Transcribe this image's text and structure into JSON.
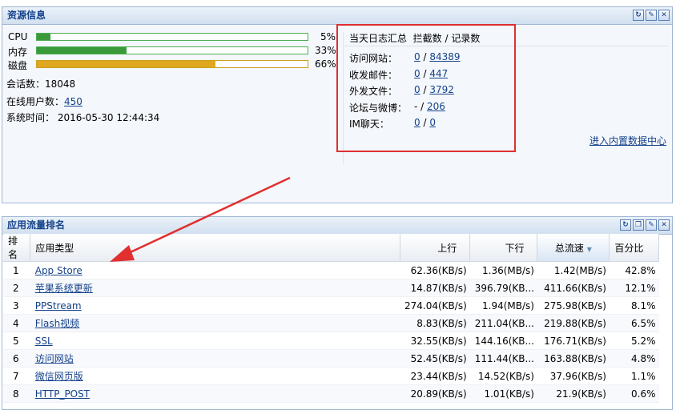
{
  "resource_panel": {
    "title": "资源信息",
    "bars": [
      {
        "label": "CPU",
        "percent_text": "5%",
        "value": 0.05,
        "color": "#3a9a3a"
      },
      {
        "label": "内存",
        "percent_text": "33%",
        "value": 0.33,
        "color": "#3a9a3a"
      },
      {
        "label": "磁盘",
        "percent_text": "66%",
        "value": 0.66,
        "color": "#e0a820"
      }
    ],
    "sessions": "会话数：18048",
    "online_users_label": "在线用户数：",
    "online_users_value": "450",
    "system_time": "系统时间： 2016-05-30 12:44:34",
    "log_summary": {
      "title": "当天日志汇总",
      "columns": "拦截数 / 记录数",
      "rows": [
        {
          "label": "访问网站：",
          "blocked": "0",
          "records": "84389"
        },
        {
          "label": "收发邮件：",
          "blocked": "0",
          "records": "447"
        },
        {
          "label": "外发文件：",
          "blocked": "0",
          "records": "3792"
        },
        {
          "label": "论坛与微博：",
          "blocked": "-",
          "records": "206"
        },
        {
          "label": "IM聊天：",
          "blocked": "0",
          "records": "0"
        }
      ]
    },
    "data_center_link": "进入内置数据中心"
  },
  "ranking_panel": {
    "title": "应用流量排名",
    "columns": {
      "rank": "排名",
      "app": "应用类型",
      "up": "上行",
      "down": "下行",
      "total": "总流速",
      "percent": "百分比"
    },
    "rows": [
      {
        "rank": "1",
        "app": "App Store",
        "up": "62.36(KB/s)",
        "down": "1.36(MB/s)",
        "total": "1.42(MB/s)",
        "percent": "42.8%"
      },
      {
        "rank": "2",
        "app": "苹果系统更新",
        "up": "14.87(KB/s)",
        "down": "396.79(KB...",
        "total": "411.66(KB/s)",
        "percent": "12.1%"
      },
      {
        "rank": "3",
        "app": "PPStream",
        "up": "274.04(KB/s)",
        "down": "1.94(MB/s)",
        "total": "275.98(KB/s)",
        "percent": "8.1%"
      },
      {
        "rank": "4",
        "app": "Flash视频",
        "up": "8.83(KB/s)",
        "down": "211.04(KB...",
        "total": "219.88(KB/s)",
        "percent": "6.5%"
      },
      {
        "rank": "5",
        "app": "SSL",
        "up": "32.55(KB/s)",
        "down": "144.16(KB...",
        "total": "176.71(KB/s)",
        "percent": "5.2%"
      },
      {
        "rank": "6",
        "app": "访问网站",
        "up": "52.45(KB/s)",
        "down": "111.44(KB...",
        "total": "163.88(KB/s)",
        "percent": "4.8%"
      },
      {
        "rank": "7",
        "app": "微信网页版",
        "up": "23.44(KB/s)",
        "down": "14.52(KB/s)",
        "total": "37.96(KB/s)",
        "percent": "1.1%"
      },
      {
        "rank": "8",
        "app": "HTTP_POST",
        "up": "20.89(KB/s)",
        "down": "1.01(KB/s)",
        "total": "21.9(KB/s)",
        "percent": "0.6%"
      }
    ]
  },
  "colors": {
    "annotation": "#e03030",
    "header_text": "#15428b"
  }
}
